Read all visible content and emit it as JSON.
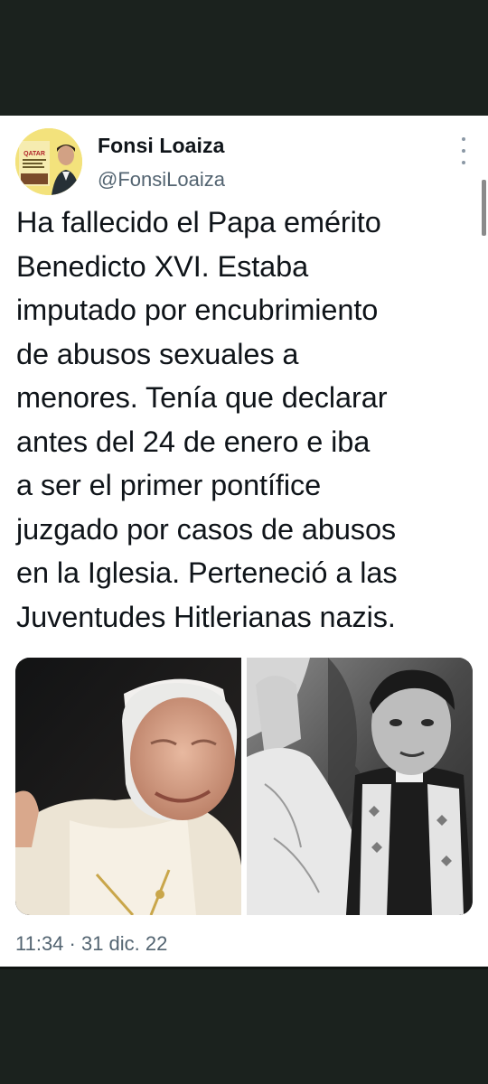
{
  "author": {
    "name": "Fonsi Loaiza",
    "handle": "@FonsiLoaiza",
    "avatar_icon": "profile-avatar",
    "avatar_book_text": "QATAR",
    "avatar_book_subtitle": "SANGRE, DINERO Y FÚTBOL"
  },
  "tweet": {
    "text": "Ha fallecido el Papa emérito\nBenedicto XVI. Estaba\nimputado por encubrimiento\nde abusos sexuales a\nmenores. Tenía que declarar\nantes del 24 de enero e iba\na ser el primer pontífice\njuzgado por casos de abusos\nen la Iglesia. Perteneció a las\nJuventudes Hitlerianas nazis.",
    "timestamp": "11:34 · 31 dic. 22"
  },
  "media": [
    {
      "name": "photo-elderly-pope",
      "icon": "photo"
    },
    {
      "name": "photo-young-priest-bw",
      "icon": "photo"
    }
  ],
  "menu_icon": "more-vertical-icon",
  "colors": {
    "frame": "#1b221e",
    "card": "#ffffff",
    "text_primary": "#0f1419",
    "text_secondary": "#536471"
  }
}
